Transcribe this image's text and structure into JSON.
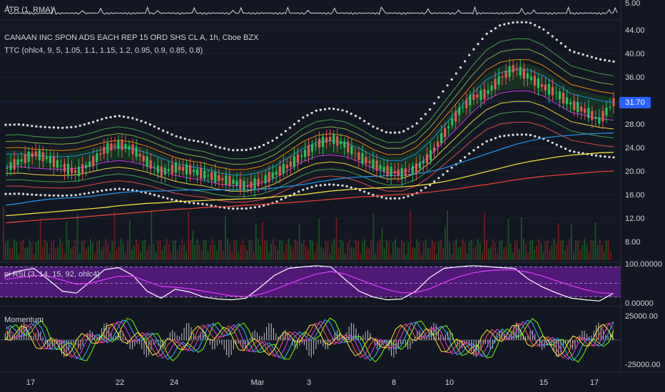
{
  "header": {
    "symbol_line": "CANAAN INC SPON ADS EACH REP 15 ORD SHS CL A, 1h, Cboe BZX",
    "indicator_line": "TTC (ohlc4, 9, 5, 1.05, 1.1, 1.15, 1.2, 0.95, 0.9, 0.85, 0.8)",
    "atr_label": "ATR (1, RMA)",
    "rsi_label": "pi RSI (3, 14, 15, 92, ohlc4)",
    "momentum_label": "Momentum"
  },
  "last_price": "31.70",
  "colors": {
    "background": "#131722",
    "up": "#26a69a",
    "up_bright": "#22c55e",
    "down": "#ef5350",
    "down_dark": "#b71c1c",
    "price_tag": "#2962ff",
    "rsi_band": "#6a1b9a",
    "rsi_line": "#ffffff",
    "rsi_signal": "#e040fb"
  },
  "chart_data": [
    {
      "type": "line",
      "title": "ATR (1, RMA)",
      "y_ticks": [
        "5.00"
      ],
      "ylim": [
        0,
        5
      ]
    },
    {
      "type": "candlestick",
      "title": "CANAAN INC SPON ADS EACH REP 15 ORD SHS CL A, 1h, Cboe BZX",
      "x_ticks": [
        "17",
        "22",
        "24",
        "Mar",
        "3",
        "8",
        "10",
        "15",
        "17"
      ],
      "y_ticks": [
        "44.00",
        "40.00",
        "36.00",
        "32.00",
        "28.00",
        "24.00",
        "20.00",
        "16.00",
        "12.00",
        "8.00"
      ],
      "ylim": [
        6,
        45
      ],
      "last_value": 31.7,
      "close_series": [
        20.5,
        21.8,
        23.0,
        22.0,
        20.6,
        19.8,
        21.4,
        23.8,
        24.6,
        23.6,
        21.4,
        19.8,
        20.6,
        20.2,
        19.4,
        18.8,
        18.2,
        17.4,
        18.2,
        19.5,
        21.0,
        22.8,
        24.6,
        25.6,
        24.4,
        22.4,
        21.2,
        20.0,
        19.6,
        20.4,
        22.6,
        26.4,
        30.0,
        32.5,
        33.2,
        35.8,
        37.6,
        36.0,
        34.4,
        33.2,
        31.4,
        30.2,
        28.6,
        31.7
      ],
      "series": [
        {
          "name": "",
          "values": [
            14.2,
            14.5,
            14.9,
            15.2,
            15.4,
            15.5,
            15.7,
            16.0,
            16.3,
            16.5,
            16.6,
            16.6,
            16.7,
            16.8,
            16.8,
            16.8,
            16.8,
            16.8,
            16.9,
            17.1,
            17.4,
            17.7,
            18.1,
            18.5,
            18.8,
            19.0,
            19.1,
            19.2,
            19.3,
            19.5,
            19.9,
            20.5,
            21.3,
            22.1,
            22.9,
            23.7,
            24.5,
            25.1,
            25.6,
            25.9,
            26.1,
            26.3,
            26.4,
            26.5
          ]
        },
        {
          "name": "",
          "values": [
            12.4,
            12.6,
            12.8,
            13.0,
            13.2,
            13.4,
            13.6,
            13.8,
            14.1,
            14.3,
            14.5,
            14.6,
            14.8,
            14.9,
            15.0,
            15.1,
            15.2,
            15.3,
            15.4,
            15.6,
            15.8,
            16.0,
            16.3,
            16.6,
            16.8,
            17.0,
            17.1,
            17.2,
            17.3,
            17.5,
            17.8,
            18.2,
            18.7,
            19.3,
            19.9,
            20.5,
            21.1,
            21.6,
            22.0,
            22.4,
            22.7,
            22.9,
            23.1,
            23.2
          ]
        },
        {
          "name": "",
          "values": [
            11.2,
            11.4,
            11.6,
            11.8,
            11.9,
            12.1,
            12.3,
            12.5,
            12.7,
            12.9,
            13.1,
            13.3,
            13.5,
            13.6,
            13.8,
            13.9,
            14.0,
            14.2,
            14.3,
            14.5,
            14.6,
            14.8,
            15.0,
            15.2,
            15.4,
            15.6,
            15.7,
            15.9,
            16.0,
            16.2,
            16.4,
            16.7,
            17.0,
            17.4,
            17.7,
            18.1,
            18.5,
            18.8,
            19.1,
            19.3,
            19.5,
            19.7,
            19.9,
            20.0
          ]
        }
      ]
    },
    {
      "type": "line",
      "title": "pi RSI (3, 14, 15, 92, ohlc4)",
      "y_ticks": [
        "100.00000",
        "0.00000"
      ],
      "ylim": [
        0,
        100
      ],
      "series": [
        {
          "name": "",
          "values": [
            70,
            82,
            88,
            60,
            30,
            25,
            55,
            85,
            90,
            70,
            30,
            12,
            35,
            28,
            15,
            10,
            8,
            12,
            40,
            70,
            88,
            92,
            95,
            92,
            60,
            30,
            15,
            8,
            10,
            30,
            65,
            88,
            92,
            95,
            93,
            90,
            88,
            60,
            40,
            25,
            12,
            8,
            5,
            25
          ]
        },
        {
          "name": "",
          "values": [
            60,
            65,
            70,
            68,
            58,
            48,
            50,
            60,
            68,
            68,
            55,
            42,
            40,
            36,
            30,
            24,
            18,
            16,
            22,
            34,
            48,
            62,
            74,
            80,
            74,
            60,
            46,
            34,
            26,
            26,
            36,
            52,
            66,
            76,
            82,
            84,
            84,
            78,
            68,
            56,
            44,
            34,
            26,
            24
          ]
        }
      ]
    },
    {
      "type": "line",
      "title": "Momentum",
      "y_ticks": [
        "25000.00",
        "-25000.00"
      ],
      "ylim": [
        -30000,
        30000
      ]
    }
  ]
}
